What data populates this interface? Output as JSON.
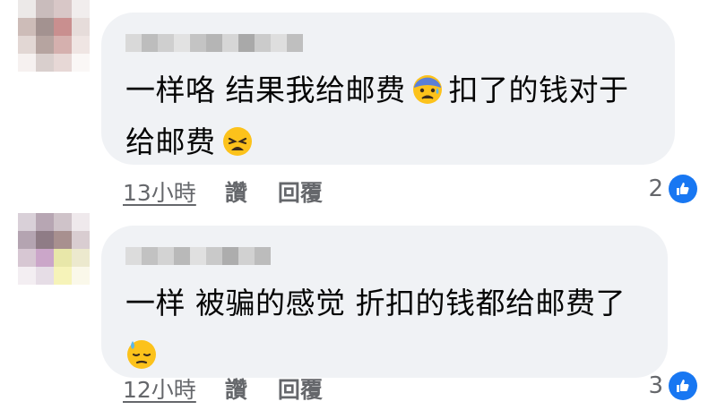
{
  "comments": [
    {
      "author_blurred": true,
      "text_line1": "一样咯 结果我给邮费",
      "emoji_1": "anxious-face-with-sweat",
      "text_line1_cont": "扣了的钱对于",
      "text_line2": "给邮费",
      "emoji_2": "weary-face",
      "time": "13小時",
      "like_label": "讚",
      "reply_label": "回覆",
      "reaction_count": "2",
      "reaction_icon": "like-icon"
    },
    {
      "author_blurred": true,
      "text_line1": "一样 被骗的感觉 折扣的钱都给邮费了",
      "emoji_1": "downcast-face-with-sweat",
      "time": "12小時",
      "like_label": "讚",
      "reply_label": "回覆",
      "reaction_count": "3",
      "reaction_icon": "like-icon"
    }
  ],
  "colors": {
    "bubble": "#f0f2f5",
    "text": "#050505",
    "meta": "#65676b",
    "like": "#1877f2"
  }
}
